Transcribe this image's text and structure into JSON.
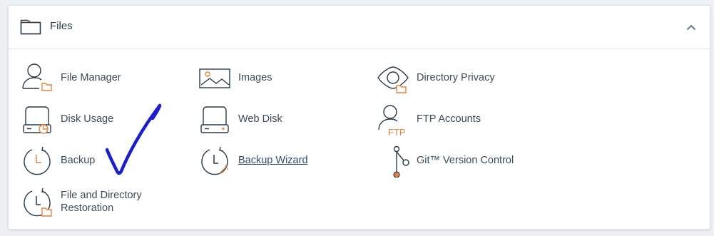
{
  "panel": {
    "title": "Files",
    "header_icon": "folder-icon",
    "collapse_icon": "chevron-up-icon"
  },
  "items": [
    {
      "label": "File Manager",
      "icon": "file-manager-icon"
    },
    {
      "label": "Images",
      "icon": "images-icon"
    },
    {
      "label": "Directory Privacy",
      "icon": "directory-privacy-icon"
    },
    {
      "label": "Disk Usage",
      "icon": "disk-usage-icon"
    },
    {
      "label": "Web Disk",
      "icon": "web-disk-icon"
    },
    {
      "label": "FTP Accounts",
      "icon": "ftp-accounts-icon"
    },
    {
      "label": "Backup",
      "icon": "backup-icon"
    },
    {
      "label": "Backup Wizard",
      "icon": "backup-wizard-icon"
    },
    {
      "label": "Git™ Version Control",
      "icon": "git-icon"
    },
    {
      "label_line1": "File and Directory",
      "label_line2": "Restoration",
      "icon": "file-restoration-icon"
    }
  ],
  "icon_text": {
    "ftp": "FTP"
  },
  "colors": {
    "accent": "#e8833a",
    "icon_stroke": "#293a4a",
    "annotation": "#1a1fc9"
  },
  "annotation": "hand-drawn-checkmark"
}
